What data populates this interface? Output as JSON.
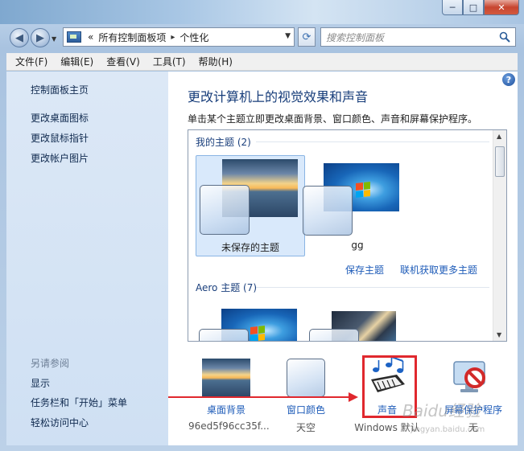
{
  "window": {
    "caption": {
      "minimize": "─",
      "maximize": "□",
      "close": "✕"
    }
  },
  "nav": {
    "back_icon": "back-arrow-icon",
    "forward_icon": "forward-arrow-icon",
    "address": {
      "prefix": "«",
      "parent": "所有控制面板项",
      "separator": "▸",
      "current": "个性化"
    },
    "refresh_icon": "refresh-icon",
    "search_placeholder": "搜索控制面板"
  },
  "menu": [
    "文件(F)",
    "编辑(E)",
    "查看(V)",
    "工具(T)",
    "帮助(H)"
  ],
  "sidebar": {
    "home": "控制面板主页",
    "links": [
      "更改桌面图标",
      "更改鼠标指针",
      "更改帐户图片"
    ],
    "see_also_heading": "另请参阅",
    "see_also": [
      "显示",
      "任务栏和「开始」菜单",
      "轻松访问中心"
    ]
  },
  "content": {
    "title": "更改计算机上的视觉效果和声音",
    "description": "单击某个主题立即更改桌面背景、窗口颜色、声音和屏幕保护程序。",
    "help_icon": "help-icon",
    "my_themes_heading": "我的主题 (2)",
    "themes": [
      {
        "name": "未保存的主题",
        "selected": true
      },
      {
        "name": "gg",
        "selected": false
      }
    ],
    "save_theme": "保存主题",
    "get_more_themes": "联机获取更多主题",
    "aero_heading": "Aero 主题 (7)"
  },
  "bottom": [
    {
      "label": "桌面背景",
      "value": "96ed5f96cc35f..."
    },
    {
      "label": "窗口颜色",
      "value": "天空"
    },
    {
      "label": "声音",
      "value": "Windows 默认"
    },
    {
      "label": "屏幕保护程序",
      "value": "无"
    }
  ],
  "annotation": {
    "highlight_color": "#e0282e"
  },
  "watermark": {
    "text": "Baidu经验",
    "sub": "jingyan.baidu.com"
  }
}
